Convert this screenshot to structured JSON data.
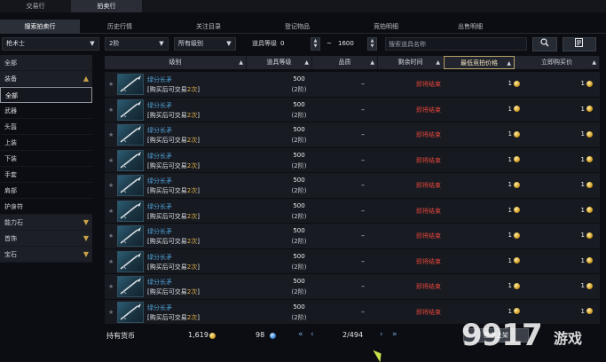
{
  "top_tabs": [
    "交易行",
    "拍卖行"
  ],
  "sub_tabs": [
    "搜索拍卖行",
    "历史行情",
    "关注目录",
    "登记物品",
    "竞拍明细",
    "出售明细"
  ],
  "filters": {
    "class": "枪术士",
    "tier": "2阶",
    "grade": "所有级别",
    "level_label": "道具等级",
    "level_min": "0",
    "level_sep": "~",
    "level_max": "1600",
    "search_placeholder": "搜索道具名称"
  },
  "sidebar": {
    "all_label": "全部",
    "equip_label": "装备",
    "equip_items": [
      "全部",
      "武器",
      "头盔",
      "上装",
      "下装",
      "手套",
      "肩部",
      "护身符"
    ],
    "cat_items": [
      "能力石",
      "首饰",
      "宝石"
    ]
  },
  "columns": {
    "grade": "级别",
    "level": "道具等级",
    "quality": "品质",
    "remaining": "剩余时间",
    "min_bid": "最低竞拍价格",
    "buyout": "立即购买价"
  },
  "rows": [
    {
      "name": "绿分长矛",
      "note_prefix": "[购买后可交易",
      "note_count": "2次",
      "note_suffix": "]",
      "level": "500",
      "tier": "(2阶)",
      "quality": "–",
      "remaining": "即将结束",
      "bid": "1",
      "buy": "1"
    },
    {
      "name": "绿分长矛",
      "note_prefix": "[购买后可交易",
      "note_count": "2次",
      "note_suffix": "]",
      "level": "500",
      "tier": "(2阶)",
      "quality": "–",
      "remaining": "即将结束",
      "bid": "1",
      "buy": "1"
    },
    {
      "name": "绿分长矛",
      "note_prefix": "[购买后可交易",
      "note_count": "2次",
      "note_suffix": "]",
      "level": "500",
      "tier": "(2阶)",
      "quality": "–",
      "remaining": "即将结束",
      "bid": "1",
      "buy": "1"
    },
    {
      "name": "绿分长矛",
      "note_prefix": "[购买后可交易",
      "note_count": "2次",
      "note_suffix": "]",
      "level": "500",
      "tier": "(2阶)",
      "quality": "–",
      "remaining": "即将结束",
      "bid": "1",
      "buy": "1"
    },
    {
      "name": "绿分长矛",
      "note_prefix": "[购买后可交易",
      "note_count": "2次",
      "note_suffix": "]",
      "level": "500",
      "tier": "(2阶)",
      "quality": "–",
      "remaining": "即将结束",
      "bid": "1",
      "buy": "1"
    },
    {
      "name": "绿分长矛",
      "note_prefix": "[购买后可交易",
      "note_count": "2次",
      "note_suffix": "]",
      "level": "500",
      "tier": "(2阶)",
      "quality": "–",
      "remaining": "即将结束",
      "bid": "1",
      "buy": "1"
    },
    {
      "name": "绿分长矛",
      "note_prefix": "[购买后可交易",
      "note_count": "2次",
      "note_suffix": "]",
      "level": "500",
      "tier": "(2阶)",
      "quality": "–",
      "remaining": "即将结束",
      "bid": "1",
      "buy": "1"
    },
    {
      "name": "绿分长矛",
      "note_prefix": "[购买后可交易",
      "note_count": "2次",
      "note_suffix": "]",
      "level": "500",
      "tier": "(2阶)",
      "quality": "–",
      "remaining": "即将结束",
      "bid": "1",
      "buy": "1"
    },
    {
      "name": "绿分长矛",
      "note_prefix": "[购买后可交易",
      "note_count": "2次",
      "note_suffix": "]",
      "level": "500",
      "tier": "(2阶)",
      "quality": "–",
      "remaining": "即将结束",
      "bid": "1",
      "buy": "1"
    },
    {
      "name": "绿分长矛",
      "note_prefix": "[购买后可交易",
      "note_count": "2次",
      "note_suffix": "]",
      "level": "500",
      "tier": "(2阶)",
      "quality": "–",
      "remaining": "即将结束",
      "bid": "1",
      "buy": "1"
    }
  ],
  "footer": {
    "currency_label": "持有货币",
    "gold": "1,619",
    "crystal": "98",
    "page": "2/494",
    "register_button": "检查上架"
  },
  "watermark": {
    "number": "9917",
    "text": "游戏"
  },
  "colors": {
    "remaining_red": "#e0453b",
    "item_blue": "#4fa3d9",
    "highlight_gold": "#e2b24d"
  }
}
